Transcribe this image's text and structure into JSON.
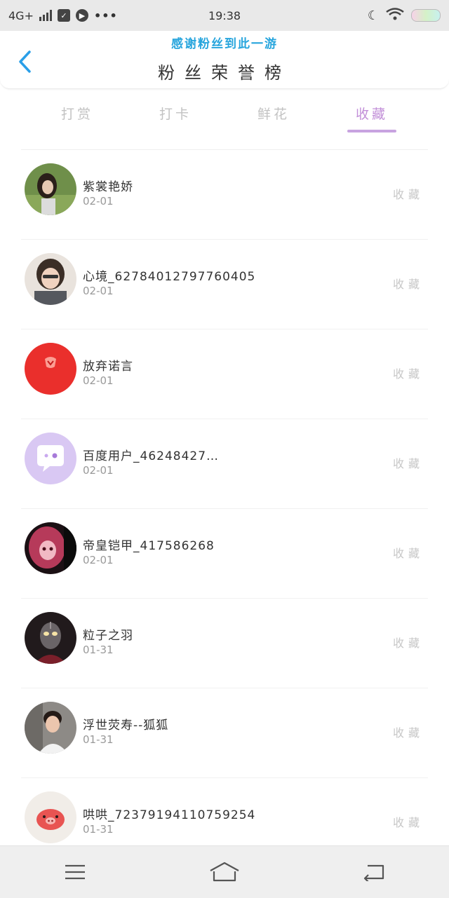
{
  "status_bar": {
    "network": "4G+",
    "time": "19:38",
    "icons": [
      "signal-icon",
      "clipboard-icon",
      "play-icon",
      "more-dots-icon",
      "moon-icon",
      "wifi-icon",
      "battery-icon"
    ]
  },
  "header": {
    "notice": "感谢粉丝到此一游",
    "title": "粉丝荣誉榜"
  },
  "tabs": [
    {
      "label": "打赏"
    },
    {
      "label": "打卡"
    },
    {
      "label": "鲜花"
    },
    {
      "label": "收藏",
      "active": true
    }
  ],
  "rows": [
    {
      "name": "紫裳艳娇",
      "date": "02-01",
      "action": "收藏"
    },
    {
      "name": "心境_62784012797760405",
      "date": "02-01",
      "action": "收藏"
    },
    {
      "name": "放弃诺言",
      "date": "02-01",
      "action": "收藏"
    },
    {
      "name": "百度用户_46248427…",
      "date": "02-01",
      "action": "收藏"
    },
    {
      "name": "帝皇铠甲_417586268",
      "date": "02-01",
      "action": "收藏"
    },
    {
      "name": "粒子之羽",
      "date": "01-31",
      "action": "收藏"
    },
    {
      "name": "浮世荧寿--狐狐",
      "date": "01-31",
      "action": "收藏"
    },
    {
      "name": "哄哄_72379194110759254",
      "date": "01-31",
      "action": "收藏"
    }
  ],
  "colors": {
    "accent_purple": "#c28fd8",
    "notice_blue": "#27a5dd",
    "back_blue": "#2a9fe8",
    "inactive_gray": "#c2c2c2"
  },
  "nav": [
    "menu-icon",
    "home-icon",
    "back-arrow-icon"
  ]
}
